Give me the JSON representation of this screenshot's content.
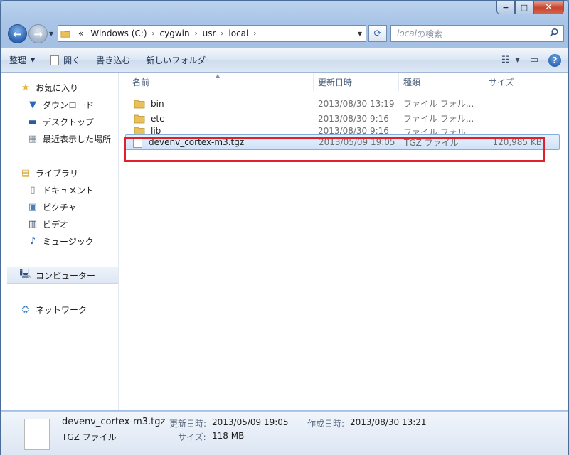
{
  "window": {
    "caption": {
      "minimize": "−",
      "maximize": "□",
      "close": "✕"
    }
  },
  "nav": {
    "back_glyph": "←",
    "forward_glyph": "→"
  },
  "address": {
    "chevron": "«",
    "crumbs": [
      "Windows (C:)",
      "cygwin",
      "usr",
      "local"
    ]
  },
  "search": {
    "placeholder_italic": "local",
    "placeholder_rest": "の検索"
  },
  "toolbar": {
    "organize": "整理",
    "open": "開く",
    "burn": "書き込む",
    "new_folder": "新しいフォルダー"
  },
  "sidebar": {
    "favorites": {
      "label": "お気に入り",
      "items": [
        "ダウンロード",
        "デスクトップ",
        "最近表示した場所"
      ]
    },
    "libraries": {
      "label": "ライブラリ",
      "items": [
        "ドキュメント",
        "ピクチャ",
        "ビデオ",
        "ミュージック"
      ]
    },
    "computer": "コンピューター",
    "network": "ネットワーク"
  },
  "columns": {
    "name": "名前",
    "date": "更新日時",
    "type": "種類",
    "size": "サイズ"
  },
  "files": [
    {
      "name": "bin",
      "date": "2013/08/30 13:19",
      "type": "ファイル フォル...",
      "size": "",
      "kind": "folder"
    },
    {
      "name": "etc",
      "date": "2013/08/30 9:16",
      "type": "ファイル フォル...",
      "size": "",
      "kind": "folder"
    },
    {
      "name": "lib",
      "date": "2013/08/30 9:16",
      "type": "ファイル フォル...",
      "size": "",
      "kind": "folder"
    },
    {
      "name": "devenv_cortex-m3.tgz",
      "date": "2013/05/09 19:05",
      "type": "TGZ ファイル",
      "size": "120,985 KB",
      "kind": "file",
      "selected": true
    }
  ],
  "details": {
    "filename": "devenv_cortex-m3.tgz",
    "filetype": "TGZ ファイル",
    "modified_label": "更新日時:",
    "modified_value": "2013/05/09 19:05",
    "size_label": "サイズ:",
    "size_value": "118 MB",
    "created_label": "作成日時:",
    "created_value": "2013/08/30 13:21"
  },
  "colors": {
    "highlight": "#e0202a",
    "selection": "#cfe2f8",
    "folder": "#e8c15a"
  }
}
